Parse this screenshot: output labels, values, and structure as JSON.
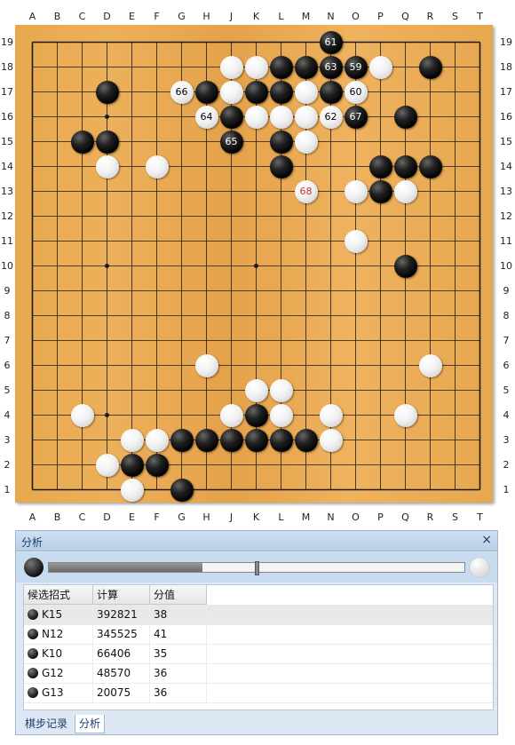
{
  "board": {
    "columns": [
      "A",
      "B",
      "C",
      "D",
      "E",
      "F",
      "G",
      "H",
      "J",
      "K",
      "L",
      "M",
      "N",
      "O",
      "P",
      "Q",
      "R",
      "S",
      "T"
    ],
    "rows": [
      "19",
      "18",
      "17",
      "16",
      "15",
      "14",
      "13",
      "12",
      "11",
      "10",
      "9",
      "8",
      "7",
      "6",
      "5",
      "4",
      "3",
      "2",
      "1"
    ],
    "star_points": [
      "D16",
      "K16",
      "Q16",
      "D10",
      "K10",
      "Q10",
      "D4",
      "K4",
      "Q4"
    ],
    "stones": [
      {
        "pos": "N19",
        "color": "black",
        "label": "61"
      },
      {
        "pos": "J18",
        "color": "white",
        "label": ""
      },
      {
        "pos": "K18",
        "color": "white",
        "label": ""
      },
      {
        "pos": "L18",
        "color": "black",
        "label": ""
      },
      {
        "pos": "M18",
        "color": "black",
        "label": ""
      },
      {
        "pos": "N18",
        "color": "black",
        "label": "63"
      },
      {
        "pos": "O18",
        "color": "black",
        "label": "59"
      },
      {
        "pos": "P18",
        "color": "white",
        "label": ""
      },
      {
        "pos": "R18",
        "color": "black",
        "label": ""
      },
      {
        "pos": "D17",
        "color": "black",
        "label": ""
      },
      {
        "pos": "G17",
        "color": "white",
        "label": "66"
      },
      {
        "pos": "H17",
        "color": "black",
        "label": ""
      },
      {
        "pos": "J17",
        "color": "white",
        "label": ""
      },
      {
        "pos": "K17",
        "color": "black",
        "label": ""
      },
      {
        "pos": "L17",
        "color": "black",
        "label": ""
      },
      {
        "pos": "M17",
        "color": "white",
        "label": ""
      },
      {
        "pos": "N17",
        "color": "black",
        "label": ""
      },
      {
        "pos": "O17",
        "color": "white",
        "label": "60"
      },
      {
        "pos": "H16",
        "color": "white",
        "label": "64"
      },
      {
        "pos": "J16",
        "color": "black",
        "label": ""
      },
      {
        "pos": "K16",
        "color": "white",
        "label": ""
      },
      {
        "pos": "L16",
        "color": "white",
        "label": ""
      },
      {
        "pos": "M16",
        "color": "white",
        "label": ""
      },
      {
        "pos": "N16",
        "color": "white",
        "label": "62"
      },
      {
        "pos": "O16",
        "color": "black",
        "label": "67"
      },
      {
        "pos": "Q16",
        "color": "black",
        "label": ""
      },
      {
        "pos": "C15",
        "color": "black",
        "label": ""
      },
      {
        "pos": "D15",
        "color": "black",
        "label": ""
      },
      {
        "pos": "J15",
        "color": "black",
        "label": "65"
      },
      {
        "pos": "L15",
        "color": "black",
        "label": ""
      },
      {
        "pos": "M15",
        "color": "white",
        "label": ""
      },
      {
        "pos": "D14",
        "color": "white",
        "label": ""
      },
      {
        "pos": "F14",
        "color": "white",
        "label": ""
      },
      {
        "pos": "L14",
        "color": "black",
        "label": ""
      },
      {
        "pos": "P14",
        "color": "black",
        "label": ""
      },
      {
        "pos": "Q14",
        "color": "black",
        "label": ""
      },
      {
        "pos": "R14",
        "color": "black",
        "label": ""
      },
      {
        "pos": "M13",
        "color": "white",
        "label": "68",
        "last": true
      },
      {
        "pos": "O13",
        "color": "white",
        "label": ""
      },
      {
        "pos": "P13",
        "color": "black",
        "label": ""
      },
      {
        "pos": "Q13",
        "color": "white",
        "label": ""
      },
      {
        "pos": "O11",
        "color": "white",
        "label": ""
      },
      {
        "pos": "Q10",
        "color": "black",
        "label": ""
      },
      {
        "pos": "H6",
        "color": "white",
        "label": ""
      },
      {
        "pos": "R6",
        "color": "white",
        "label": ""
      },
      {
        "pos": "K5",
        "color": "white",
        "label": ""
      },
      {
        "pos": "L5",
        "color": "white",
        "label": ""
      },
      {
        "pos": "C4",
        "color": "white",
        "label": ""
      },
      {
        "pos": "J4",
        "color": "white",
        "label": ""
      },
      {
        "pos": "K4",
        "color": "black",
        "label": ""
      },
      {
        "pos": "L4",
        "color": "white",
        "label": ""
      },
      {
        "pos": "N4",
        "color": "white",
        "label": ""
      },
      {
        "pos": "Q4",
        "color": "white",
        "label": ""
      },
      {
        "pos": "E3",
        "color": "white",
        "label": ""
      },
      {
        "pos": "F3",
        "color": "white",
        "label": ""
      },
      {
        "pos": "G3",
        "color": "black",
        "label": ""
      },
      {
        "pos": "H3",
        "color": "black",
        "label": ""
      },
      {
        "pos": "J3",
        "color": "black",
        "label": ""
      },
      {
        "pos": "K3",
        "color": "black",
        "label": ""
      },
      {
        "pos": "L3",
        "color": "black",
        "label": ""
      },
      {
        "pos": "M3",
        "color": "black",
        "label": ""
      },
      {
        "pos": "N3",
        "color": "white",
        "label": ""
      },
      {
        "pos": "D2",
        "color": "white",
        "label": ""
      },
      {
        "pos": "E2",
        "color": "black",
        "label": ""
      },
      {
        "pos": "F2",
        "color": "black",
        "label": ""
      },
      {
        "pos": "E1",
        "color": "white",
        "label": ""
      },
      {
        "pos": "G1",
        "color": "black",
        "label": ""
      }
    ]
  },
  "panel": {
    "title": "分析",
    "close": "×",
    "slider_black_fraction": 0.37,
    "slider_thumb_fraction": 0.5,
    "headers": [
      "候选招式",
      "计算",
      "分值"
    ],
    "rows": [
      {
        "move": "K15",
        "count": "392821",
        "score": "38",
        "selected": true
      },
      {
        "move": "N12",
        "count": "345525",
        "score": "41"
      },
      {
        "move": "K10",
        "count": "66406",
        "score": "35"
      },
      {
        "move": "G12",
        "count": "48570",
        "score": "36"
      },
      {
        "move": "G13",
        "count": "20075",
        "score": "36"
      }
    ],
    "tabs": [
      {
        "label": "棋步记录",
        "active": false
      },
      {
        "label": "分析",
        "active": true
      }
    ]
  },
  "colors": {
    "board": "#e9aa52",
    "last_move_label": "#c0392b",
    "panel_bg": "#dde8f4"
  }
}
